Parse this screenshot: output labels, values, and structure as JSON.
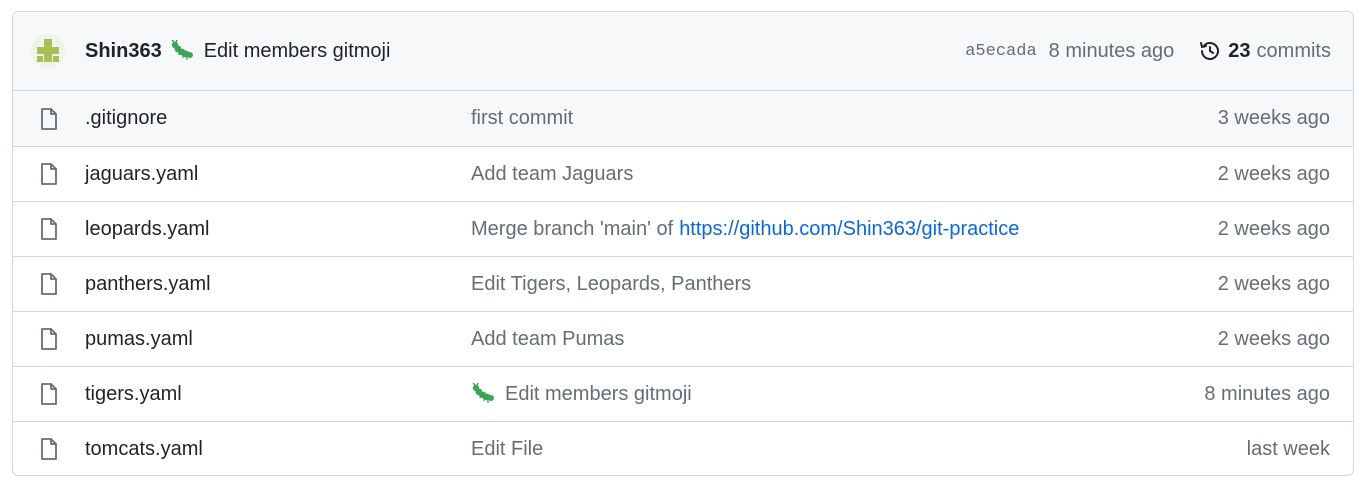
{
  "latest_commit": {
    "author": "Shin363",
    "message": "Edit members gitmoji",
    "emoji": "caterpillar-icon",
    "sha": "a5ecada",
    "time": "8 minutes ago",
    "commit_count": "23",
    "commits_label": "commits"
  },
  "files": [
    {
      "name": ".gitignore",
      "message": "first commit",
      "time": "3 weeks ago"
    },
    {
      "name": "jaguars.yaml",
      "message": "Add team Jaguars",
      "time": "2 weeks ago"
    },
    {
      "name": "leopards.yaml",
      "message": "Merge branch 'main' of",
      "link": "https://github.com/Shin363/git-practice",
      "time": "2 weeks ago"
    },
    {
      "name": "panthers.yaml",
      "message": "Edit Tigers, Leopards, Panthers",
      "time": "2 weeks ago"
    },
    {
      "name": "pumas.yaml",
      "message": "Add team Pumas",
      "time": "2 weeks ago"
    },
    {
      "name": "tigers.yaml",
      "message": "Edit members gitmoji",
      "time": "8 minutes ago"
    },
    {
      "name": "tomcats.yaml",
      "message": "Edit File",
      "time": "last week"
    }
  ],
  "colors": {
    "link": "#0969da",
    "muted": "#656d76",
    "border": "#d0d7de",
    "header_bg": "#f6f8fa",
    "avatar_fg": "#a7c159",
    "caterpillar": "#3aa657"
  }
}
